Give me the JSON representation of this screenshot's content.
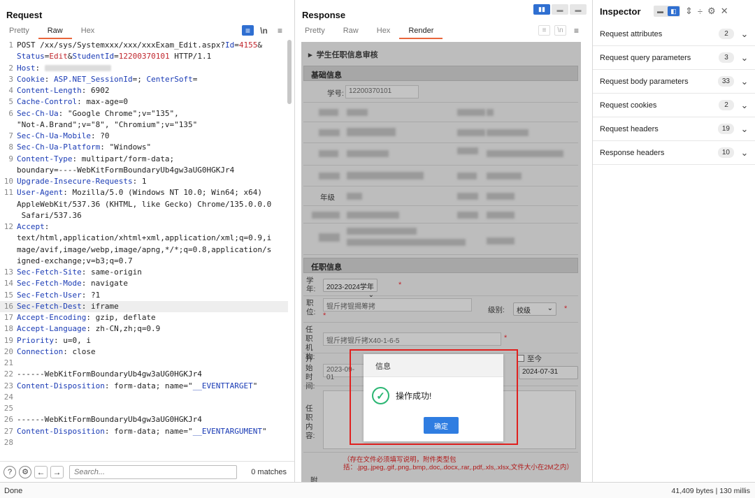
{
  "request": {
    "title": "Request",
    "tabs": [
      "Pretty",
      "Raw",
      "Hex"
    ],
    "lines": [
      {
        "n": "1",
        "html": "POST /xx/sys/Systemxxx/xxx/xxxExam_Edit.aspx?<span class='k'>Id</span>=<span class='r'>4155</span>&amp;"
      },
      {
        "n": "",
        "html": "<span class='k'>Status</span>=<span class='r'>Edit</span>&amp;<span class='k'>StudentId</span>=<span class='r'>12200370101</span> HTTP/1.1"
      },
      {
        "n": "2",
        "html": "<span class='k'>Host</span>: <span class='blur'></span>"
      },
      {
        "n": "3",
        "html": "<span class='k'>Cookie</span>: <span class='k'>ASP.NET_SessionId</span>=; <span class='k'>CenterSoft</span>="
      },
      {
        "n": "4",
        "html": "<span class='k'>Content-Length</span>: 6902"
      },
      {
        "n": "5",
        "html": "<span class='k'>Cache-Control</span>: max-age=0"
      },
      {
        "n": "6",
        "html": "<span class='k'>Sec-Ch-Ua</span>: \"Google Chrome\";v=\"135\","
      },
      {
        "n": "",
        "html": "\"Not-A.Brand\";v=\"8\", \"Chromium\";v=\"135\""
      },
      {
        "n": "7",
        "html": "<span class='k'>Sec-Ch-Ua-Mobile</span>: ?0"
      },
      {
        "n": "8",
        "html": "<span class='k'>Sec-Ch-Ua-Platform</span>: \"Windows\""
      },
      {
        "n": "9",
        "html": "<span class='k'>Content-Type</span>: multipart/form-data;"
      },
      {
        "n": "",
        "html": "boundary=----WebKitFormBoundaryUb4gw3aUG0HGKJr4"
      },
      {
        "n": "10",
        "html": "<span class='k'>Upgrade-Insecure-Requests</span>: 1"
      },
      {
        "n": "11",
        "html": "<span class='k'>User-Agent</span>: Mozilla/5.0 (Windows NT 10.0; Win64; x64)"
      },
      {
        "n": "",
        "html": "AppleWebKit/537.36 (KHTML, like Gecko) Chrome/135.0.0.0"
      },
      {
        "n": "",
        "html": " Safari/537.36"
      },
      {
        "n": "12",
        "html": "<span class='k'>Accept</span>:"
      },
      {
        "n": "",
        "html": "text/html,application/xhtml+xml,application/xml;q=0.9,i"
      },
      {
        "n": "",
        "html": "mage/avif,image/webp,image/apng,*/*;q=0.8,application/s"
      },
      {
        "n": "",
        "html": "igned-exchange;v=b3;q=0.7"
      },
      {
        "n": "13",
        "html": "<span class='k'>Sec-Fetch-Site</span>: same-origin"
      },
      {
        "n": "14",
        "html": "<span class='k'>Sec-Fetch-Mode</span>: navigate"
      },
      {
        "n": "15",
        "html": "<span class='k'>Sec-Fetch-User</span>: ?1"
      },
      {
        "n": "16",
        "html": "<span class='k'>Sec-Fetch-Dest</span>: iframe",
        "hl": true
      },
      {
        "n": "17",
        "html": "<span class='k'>Accept-Encoding</span>: gzip, deflate"
      },
      {
        "n": "18",
        "html": "<span class='k'>Accept-Language</span>: zh-CN,zh;q=0.9"
      },
      {
        "n": "19",
        "html": "<span class='k'>Priority</span>: u=0, i"
      },
      {
        "n": "20",
        "html": "<span class='k'>Connection</span>: close"
      },
      {
        "n": "21",
        "html": ""
      },
      {
        "n": "22",
        "html": "------WebKitFormBoundaryUb4gw3aUG0HGKJr4"
      },
      {
        "n": "23",
        "html": "<span class='k'>Content-Disposition</span>: form-data; name=\"<span class='k'>__EVENTTARGET</span>\""
      },
      {
        "n": "24",
        "html": ""
      },
      {
        "n": "25",
        "html": ""
      },
      {
        "n": "26",
        "html": "------WebKitFormBoundaryUb4gw3aUG0HGKJr4"
      },
      {
        "n": "27",
        "html": "<span class='k'>Content-Disposition</span>: form-data; name=\"<span class='k'>__EVENTARGUMENT</span>\""
      },
      {
        "n": "28",
        "html": ""
      }
    ],
    "search_placeholder": "Search...",
    "matches": "0 matches"
  },
  "response": {
    "title": "Response",
    "tabs": [
      "Pretty",
      "Raw",
      "Hex",
      "Render"
    ],
    "render": {
      "page_title": "学生任职信息审核",
      "section_basic": "基础信息",
      "student_no_label": "学号:",
      "student_no_value": "12200370101",
      "grade_label": "年级",
      "section_job": "任职信息",
      "year_label": "学年:",
      "year_value": "2023-2024学年",
      "position_label": "职位:",
      "position_value": "锟斤拷锟揭筹拷",
      "level_label": "级别:",
      "level_value": "校级",
      "org_label": "任职机构:",
      "org_value": "锟斤拷锟斤拷X40-1-6-5",
      "start_label": "开始时间:",
      "start_value": "2023-09-01",
      "till_now": "至今",
      "end_value": "2024-07-31",
      "content_label": "任职内容:",
      "attach_label": "附",
      "note": "（存在文件必须填写说明，附件类型包括：.jpg,.jpeg,.gif,.png,.bmp,.doc,.docx,.rar,.pdf,.xls,.xlsx,文件大小在2M之内）"
    },
    "dialog": {
      "title": "信息",
      "message": "操作成功!",
      "ok": "确定"
    }
  },
  "inspector": {
    "title": "Inspector",
    "sections": [
      {
        "label": "Request attributes",
        "count": "2"
      },
      {
        "label": "Request query parameters",
        "count": "3"
      },
      {
        "label": "Request body parameters",
        "count": "33"
      },
      {
        "label": "Request cookies",
        "count": "2"
      },
      {
        "label": "Request headers",
        "count": "19"
      },
      {
        "label": "Response headers",
        "count": "10"
      }
    ]
  },
  "status": {
    "left": "Done",
    "right": "41,409 bytes | 130 millis"
  },
  "colors": {
    "accent": "#2f6fd1",
    "tab_underline": "#e8663c",
    "header_key": "#1a3bb5",
    "value_red": "#c0262d",
    "highlight_box": "#e0201e",
    "success_green": "#2bb673"
  }
}
